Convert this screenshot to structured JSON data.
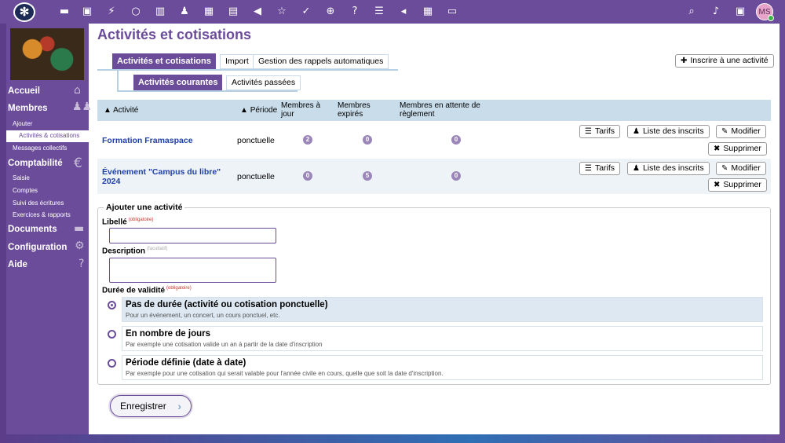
{
  "topbar": {
    "logo": "✻",
    "avatar": "MS",
    "icons": [
      "folder-icon",
      "image-icon",
      "bolt-icon",
      "search-icon",
      "columns-icon",
      "users-icon",
      "calendar-icon",
      "printer-icon",
      "megaphone-icon",
      "sparkle-icon",
      "check-icon",
      "globe-icon",
      "help-icon",
      "list-icon",
      "tag-icon",
      "grid-icon",
      "laptop-icon"
    ],
    "right_icons": [
      "search-icon",
      "bell-icon",
      "archive-icon"
    ]
  },
  "sidebar": {
    "accueil": "Accueil",
    "membres": "Membres",
    "ajouter": "Ajouter",
    "activites": "Activités & cotisations",
    "messages": "Messages collectifs",
    "comptabilite": "Comptabilité",
    "saisie": "Saisie",
    "comptes": "Comptes",
    "suivi": "Suivi des écritures",
    "exercices": "Exercices & rapports",
    "documents": "Documents",
    "configuration": "Configuration",
    "aide": "Aide"
  },
  "page": {
    "title": "Activités et cotisations",
    "tabs": [
      "Activités et cotisations",
      "Import",
      "Gestion des rappels automatiques"
    ],
    "subtabs": [
      "Activités courantes",
      "Activités passées"
    ],
    "inscribe_button": "Inscrire à une activité"
  },
  "table": {
    "headers": {
      "activite": "Activité",
      "periode": "Période",
      "membres_a_jour": "Membres à jour",
      "membres_expires": "Membres expirés",
      "en_attente": "Membres en attente de règlement"
    },
    "rows": [
      {
        "name": "Formation Framaspace",
        "period": "ponctuelle",
        "a_jour": "2",
        "expires": "0",
        "attente": "0"
      },
      {
        "name": "Événement \"Campus du libre\" 2024",
        "period": "ponctuelle",
        "a_jour": "0",
        "expires": "5",
        "attente": "0"
      }
    ],
    "actions": {
      "tarifs": "Tarifs",
      "liste": "Liste des inscrits",
      "modifier": "Modifier",
      "supprimer": "Supprimer"
    }
  },
  "form": {
    "legend": "Ajouter une activité",
    "libelle_label": "Libellé",
    "required": "(obligatoire)",
    "optional": "(facultatif)",
    "description_label": "Description",
    "duree_label": "Durée de validité",
    "options": [
      {
        "title": "Pas de durée (activité ou cotisation ponctuelle)",
        "desc": "Pour un événement, un concert, un cours ponctuel, etc.",
        "selected": true
      },
      {
        "title": "En nombre de jours",
        "desc": "Par exemple une cotisation valide un an à partir de la date d'inscription",
        "selected": false
      },
      {
        "title": "Période définie (date à date)",
        "desc": "Par exemple pour une cotisation qui serait valable pour l'année civile en cours, quelle que soit la date d'inscription.",
        "selected": false
      }
    ],
    "save": "Enregistrer"
  },
  "colors": {
    "accent": "#6b4c9a",
    "link": "#1f3fa8",
    "header": "#c8dcea"
  }
}
